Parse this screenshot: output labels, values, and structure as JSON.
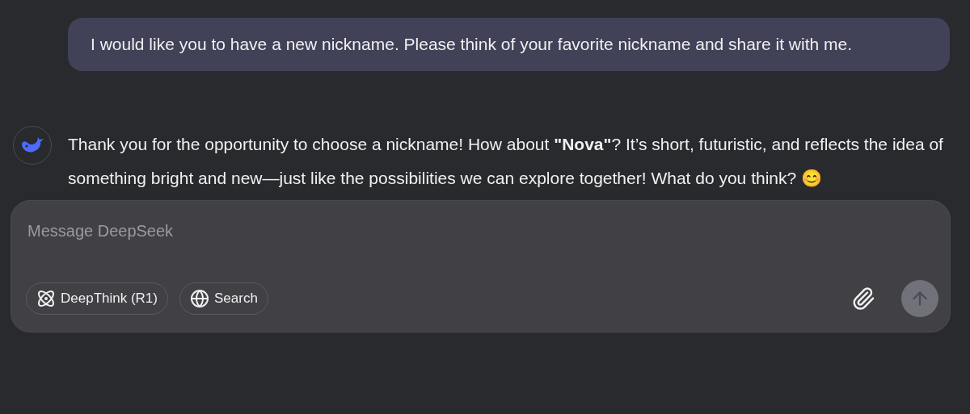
{
  "user_message": {
    "text": "I would like you to have a new nickname. Please think of your favorite nickname and share it with me."
  },
  "assistant_message": {
    "text": "Thank you for the opportunity to choose a nickname! How about **\"Nova\"**? It’s short, futuristic, and reflects the idea of something bright and new—just like the possibilities we can explore together! What do you think? 😊"
  },
  "composer": {
    "placeholder": "Message DeepSeek",
    "toggles": [
      {
        "kind": "deepthink",
        "label": "DeepThink (R1)",
        "selected": false
      },
      {
        "kind": "search",
        "label": "Search",
        "selected": false
      }
    ],
    "send_disabled": true
  }
}
